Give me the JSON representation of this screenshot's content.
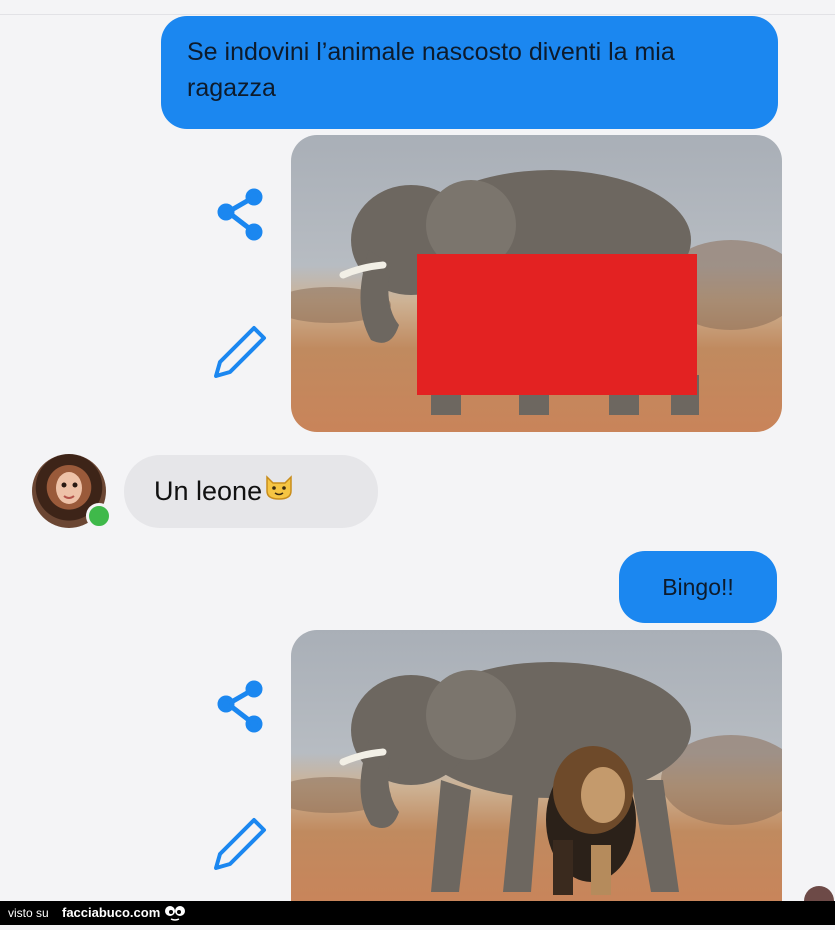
{
  "messages": {
    "first": "Se indovini l’animale  nascosto diventi la mia ragazza",
    "reply": "Un leone",
    "reply_emoji": "cat-face-emoji",
    "second": "Bingo!!"
  },
  "footer": {
    "visto": "visto su",
    "brand": "facciabuco.com"
  },
  "colors": {
    "outgoing_bubble": "#1b87f0",
    "incoming_bubble": "#e6e6e9",
    "icon_blue": "#1b87f0",
    "censor_red": "#e32222",
    "online_dot": "#3fb94a"
  }
}
